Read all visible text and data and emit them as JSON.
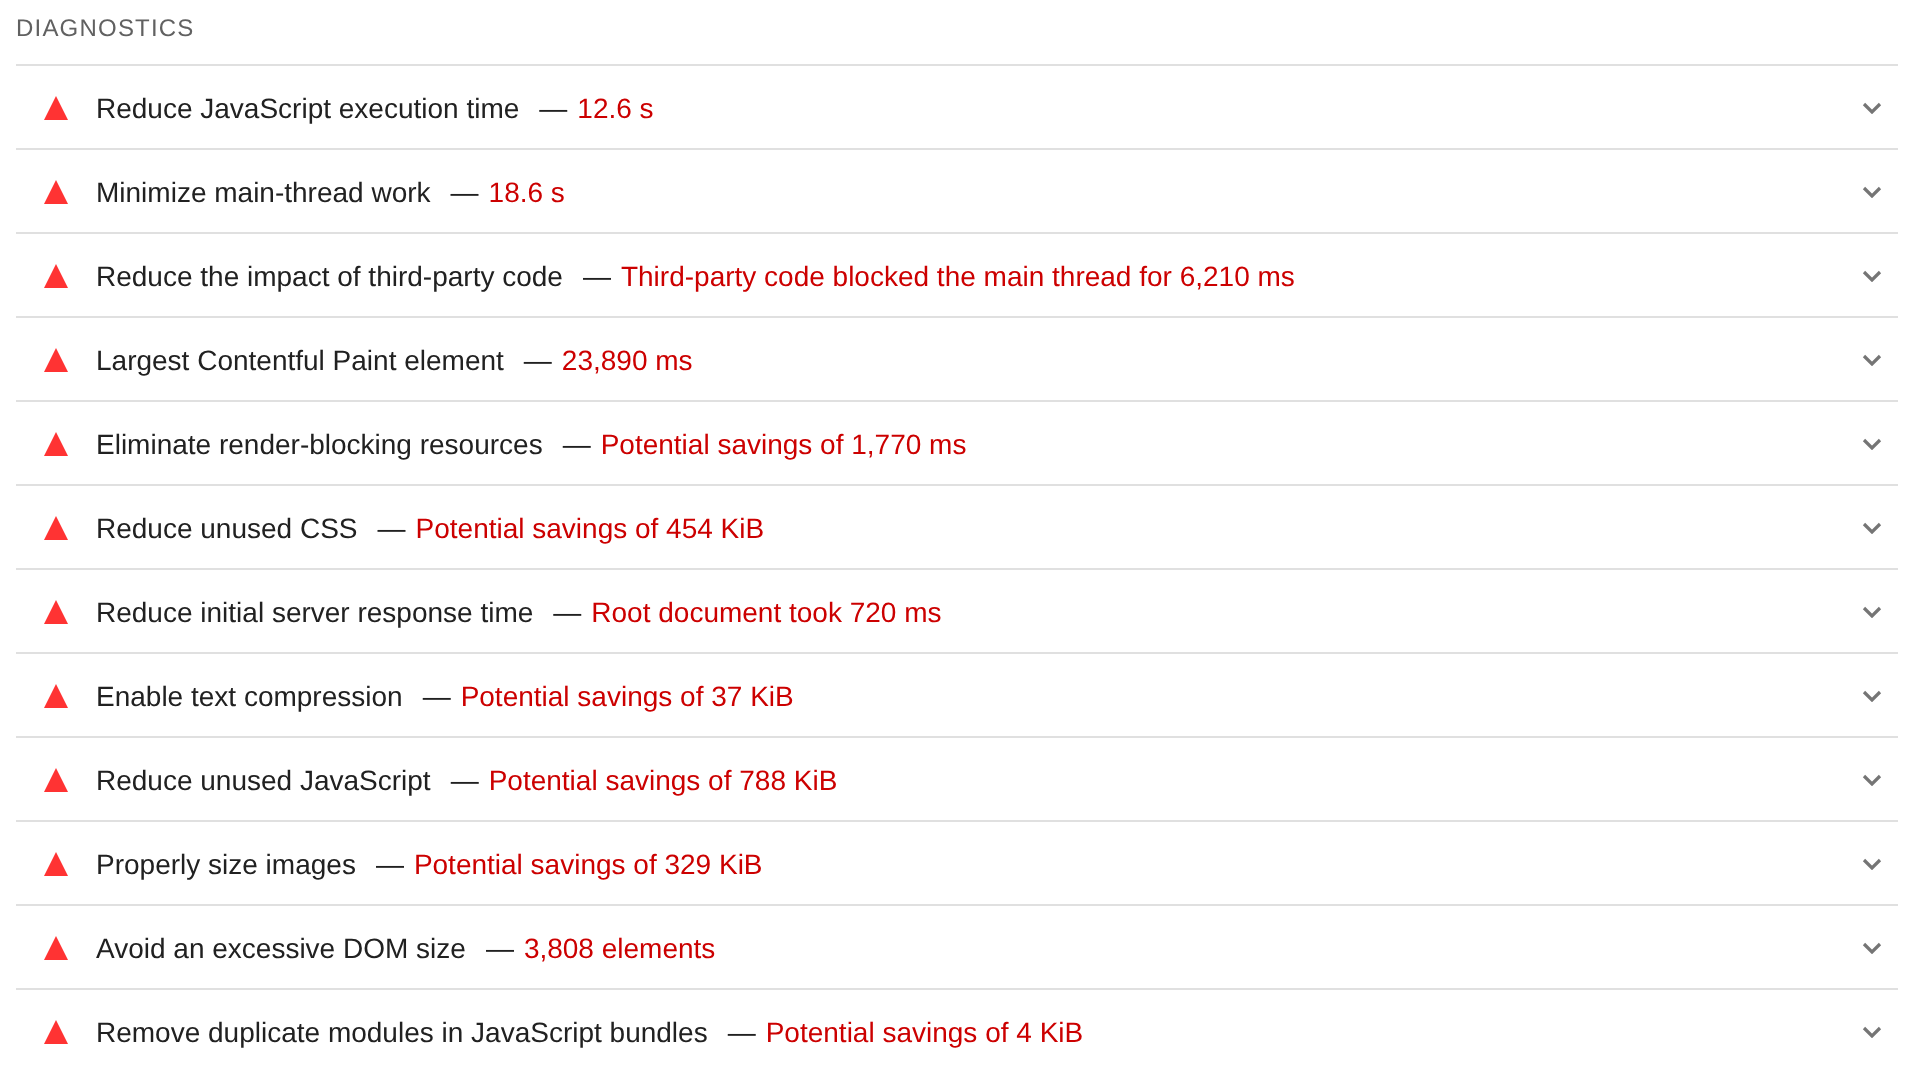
{
  "section": {
    "title": "DIAGNOSTICS"
  },
  "audits": [
    {
      "title": "Reduce JavaScript execution time",
      "separator": "—",
      "value": "12.6 s",
      "expanded": false
    },
    {
      "title": "Minimize main-thread work",
      "separator": "—",
      "value": "18.6 s",
      "expanded": false
    },
    {
      "title": "Reduce the impact of third-party code",
      "separator": "—",
      "value": "Third-party code blocked the main thread for 6,210 ms",
      "expanded": false
    },
    {
      "title": "Largest Contentful Paint element",
      "separator": "—",
      "value": "23,890 ms",
      "expanded": false
    },
    {
      "title": "Eliminate render-blocking resources",
      "separator": "—",
      "value": "Potential savings of 1,770 ms",
      "expanded": false
    },
    {
      "title": "Reduce unused CSS",
      "separator": "—",
      "value": "Potential savings of 454 KiB",
      "expanded": false
    },
    {
      "title": "Reduce initial server response time",
      "separator": "—",
      "value": "Root document took 720 ms",
      "expanded": false
    },
    {
      "title": "Enable text compression",
      "separator": "—",
      "value": "Potential savings of 37 KiB",
      "expanded": false
    },
    {
      "title": "Reduce unused JavaScript",
      "separator": "—",
      "value": "Potential savings of 788 KiB",
      "expanded": false
    },
    {
      "title": "Properly size images",
      "separator": "—",
      "value": "Potential savings of 329 KiB",
      "expanded": false
    },
    {
      "title": "Avoid an excessive DOM size",
      "separator": "—",
      "value": "3,808 elements",
      "expanded": false
    },
    {
      "title": "Remove duplicate modules in JavaScript bundles",
      "separator": "—",
      "value": "Potential savings of 4 KiB",
      "expanded": false
    }
  ]
}
